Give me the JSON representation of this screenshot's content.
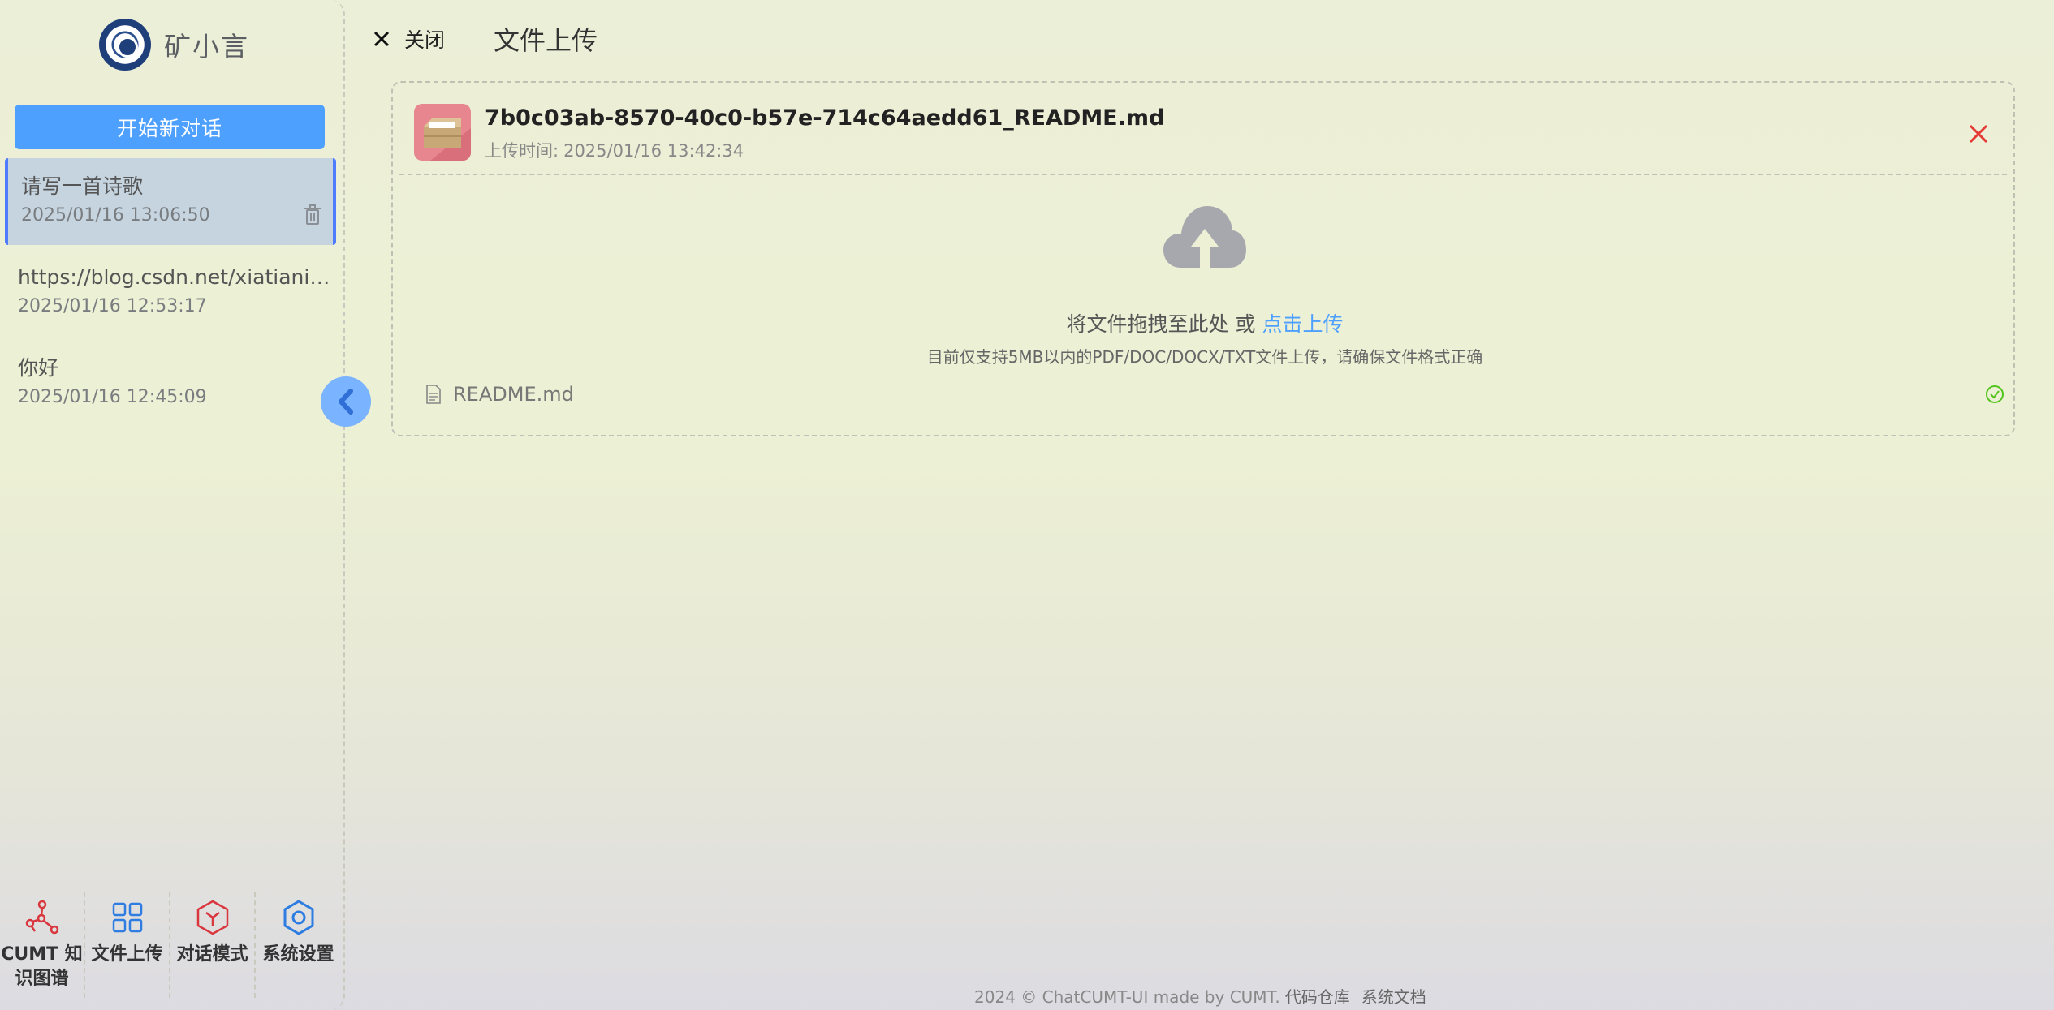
{
  "sidebar": {
    "brand_name": "矿小言",
    "new_chat_label": "开始新对话",
    "chats": [
      {
        "title": "请写一首诗歌",
        "time": "2025/01/16 13:06:50"
      },
      {
        "title": "https://blog.csdn.net/xiatianit/arti...",
        "time": "2025/01/16 12:53:17"
      },
      {
        "title": "你好",
        "time": "2025/01/16 12:45:09"
      }
    ],
    "bottom_nav": [
      {
        "label": "CUMT 知识图谱",
        "icon": "graph-icon",
        "color": "#d9363e"
      },
      {
        "label": "文件上传",
        "icon": "grid-icon",
        "color": "#2f7de1"
      },
      {
        "label": "对话模式",
        "icon": "cube-icon",
        "color": "#d9363e"
      },
      {
        "label": "系统设置",
        "icon": "settings-icon",
        "color": "#2f7de1"
      }
    ]
  },
  "topbar": {
    "close_label": "关闭",
    "title": "文件上传"
  },
  "upload": {
    "file_name": "7b0c03ab-8570-40c0-b57e-714c64aedd61_README.md",
    "upload_time_label": "上传时间:",
    "upload_time": "2025/01/16 13:42:34",
    "drop_text": "将文件拖拽至此处 或 ",
    "click_upload": "点击上传",
    "tip": "目前仅支持5MB以内的PDF/DOC/DOCX/TXT文件上传，请确保文件格式正确",
    "uploaded_file": "README.md"
  },
  "footer": {
    "text": "2024 © ChatCUMT-UI made by CUMT.",
    "repo_link": "代码仓库",
    "docs_link": "系统文档"
  },
  "colors": {
    "accent": "#4ea0ff",
    "active_border": "#4f7cff",
    "remove": "#e53935",
    "success": "#52c41a"
  }
}
